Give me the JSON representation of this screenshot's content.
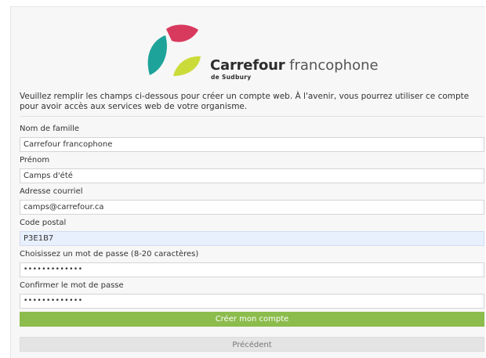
{
  "logo": {
    "name_bold": "Carrefour",
    "name_light": "francophone",
    "subtitle": "de Sudbury",
    "colors": {
      "teal": "#1ea39a",
      "crimson": "#d83a5e",
      "lime": "#cbdb3a"
    }
  },
  "intro": "Veuillez remplir les champs ci-dessous pour créer un compte web. À l'avenir, vous pourrez utiliser ce compte pour avoir accès aux services web de votre organisme.",
  "form": {
    "last_name": {
      "label": "Nom de famille",
      "value": "Carrefour francophone"
    },
    "first_name": {
      "label": "Prénom",
      "value": "Camps d'été"
    },
    "email": {
      "label": "Adresse courriel",
      "value": "camps@carrefour.ca"
    },
    "postal_code": {
      "label": "Code postal",
      "value": "P3E1B7"
    },
    "password": {
      "label": "Choisissez un mot de passe (8-20 caractères)",
      "value": "•••••••••••••"
    },
    "confirm_password": {
      "label": "Confirmer le mot de passe",
      "value": "•••••••••••••"
    }
  },
  "buttons": {
    "create": "Créer mon compte",
    "previous": "Précédent"
  },
  "colors": {
    "primary_button": "#8cbc4c",
    "secondary_button": "#e4e4e4",
    "autofill": "#e8f0fe"
  }
}
